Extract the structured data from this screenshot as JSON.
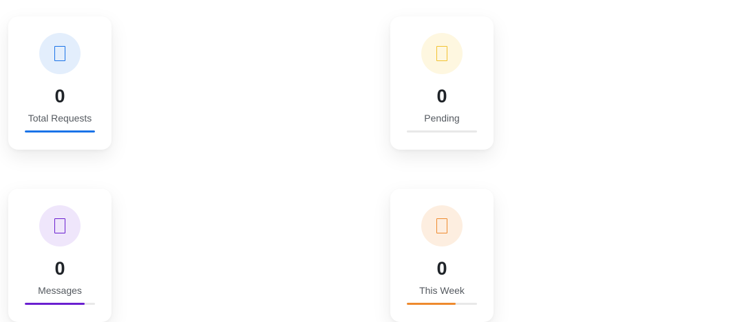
{
  "cards": [
    {
      "label": "Total Requests",
      "value": "0",
      "icon": "document-icon",
      "icon_color": "#1a73e8",
      "icon_bg": "#e3eefc",
      "bar_color": "#1a73e8",
      "progress": 1.0
    },
    {
      "label": "Pending",
      "value": "0",
      "icon": "clock-icon",
      "icon_color": "#f2c230",
      "icon_bg": "#fef7e0",
      "bar_color": "#f2c230",
      "progress": 0.0
    },
    {
      "label": "Messages",
      "value": "0",
      "icon": "message-icon",
      "icon_color": "#6a1fd0",
      "icon_bg": "#efe6fb",
      "bar_color": "#6a1fd0",
      "progress": 0.85
    },
    {
      "label": "This Week",
      "value": "0",
      "icon": "calendar-icon",
      "icon_color": "#ee8a2e",
      "icon_bg": "#fdeee0",
      "bar_color": "#ee8a2e",
      "progress": 0.7
    }
  ]
}
